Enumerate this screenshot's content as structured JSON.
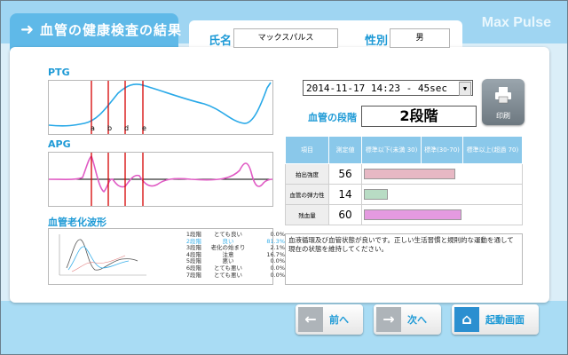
{
  "header": {
    "title": "血管の健康検査の結果",
    "brand": "Max Pulse",
    "name_label": "氏名",
    "name_value": "マックスパルス",
    "sex_label": "性別",
    "sex_value": "男"
  },
  "graphs": {
    "ptg_label": "PTG",
    "apg_label": "APG",
    "aging_label": "血管老化波形",
    "markers": [
      "a",
      "b",
      "d",
      "e"
    ]
  },
  "stages": [
    {
      "stage": "1段階",
      "desc": "とても良い",
      "pct": "0.0%"
    },
    {
      "stage": "2段階",
      "desc": "良い",
      "pct": "81.3%"
    },
    {
      "stage": "3段階",
      "desc": "老化の始まり",
      "pct": "2.1%"
    },
    {
      "stage": "4段階",
      "desc": "注意",
      "pct": "16.7%"
    },
    {
      "stage": "5段階",
      "desc": "悪い",
      "pct": "0.0%"
    },
    {
      "stage": "6段階",
      "desc": "とても悪い",
      "pct": "0.0%"
    },
    {
      "stage": "7段階",
      "desc": "とても悪い",
      "pct": "0.0%"
    }
  ],
  "measurement": {
    "datetime": "2014-11-17 14:23 - 45sec",
    "stage_label": "血管の段階",
    "stage_value": "2段階",
    "print_label": "印刷"
  },
  "results": {
    "headers": [
      "項目",
      "測定値",
      "標準以下(未満 30)",
      "標準(30-70)",
      "標準以上(超過 70)"
    ],
    "rows": [
      {
        "name": "拍出強度",
        "value": "56",
        "level": 56,
        "color": "#e7b8c4"
      },
      {
        "name": "血管の弾力性",
        "value": "14",
        "level": 14,
        "color": "#b8dcc4"
      },
      {
        "name": "残血量",
        "value": "60",
        "level": 60,
        "color": "#e49ae0"
      }
    ]
  },
  "comment": "血液循環及び血管状態が良いです。正しい生活習慣と規則的な運動を通して現在の状態を維持してください。",
  "nav": {
    "prev": "前へ",
    "next": "次へ",
    "home": "起動画面"
  }
}
